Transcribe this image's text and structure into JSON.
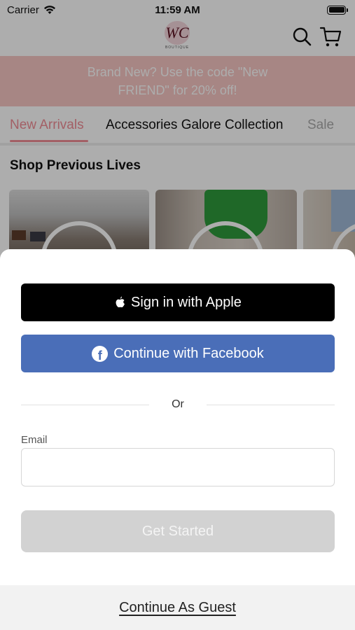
{
  "status_bar": {
    "carrier": "Carrier",
    "time": "11:59 AM"
  },
  "header": {
    "logo_text": "WC",
    "logo_sub": "BOUTIQUE"
  },
  "promo": {
    "text": "Brand New? Use the code \"New FRIEND\" for 20% off!"
  },
  "tabs": [
    {
      "label": "New Arrivals",
      "active": true
    },
    {
      "label": "Accessories Galore Collection",
      "active": false
    },
    {
      "label": "Sale",
      "active": false
    }
  ],
  "section": {
    "title": "Shop Previous Lives"
  },
  "sheet": {
    "apple_label": "Sign in with Apple",
    "facebook_label": "Continue with Facebook",
    "divider_text": "Or",
    "email_label": "Email",
    "email_value": "",
    "email_placeholder": "",
    "get_started_label": "Get Started",
    "guest_label": "Continue As Guest"
  },
  "colors": {
    "promo_bg": "#f6c6c3",
    "tab_accent": "#f08c96",
    "facebook": "#4a6eb8",
    "apple": "#000000",
    "disabled_button": "#d2d2d2"
  }
}
